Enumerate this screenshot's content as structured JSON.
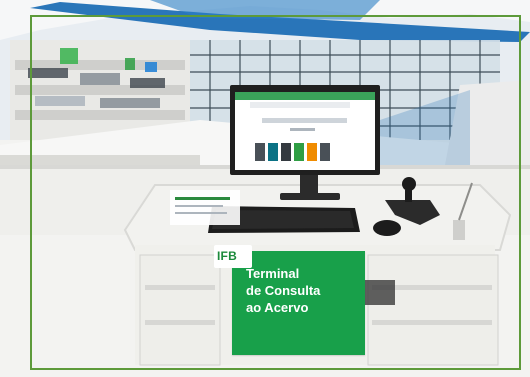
{
  "photo": {
    "description_colors": {
      "frame": "#5d9a3a",
      "sign": "#18a04a",
      "ceiling_blue": "#1f6fb5",
      "desk": "#f2f2ef"
    }
  },
  "sign": {
    "logo": "IFB",
    "title": "Terminal\nde Consulta\nao Acervo"
  }
}
